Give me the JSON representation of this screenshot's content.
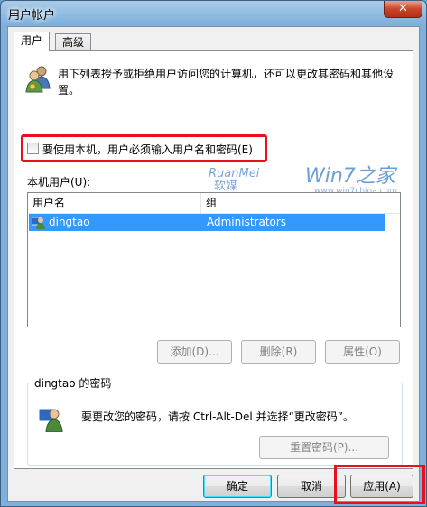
{
  "window": {
    "title": "用户帐户",
    "close_label": "✕"
  },
  "tabs": [
    {
      "label": "用户"
    },
    {
      "label": "高级"
    }
  ],
  "description": "用下列表授予或拒绝用户访问您的计算机，还可以更改其密码和其他设置。",
  "checkbox": {
    "label": "要使用本机，用户必须输入用户名和密码(E)",
    "checked": false
  },
  "watermark": {
    "ruanmei": "RuanMei",
    "ruanmei_cn": "软媒",
    "win7": "Win7之家",
    "win7_url": "www.win7china.com"
  },
  "users_section": {
    "label": "本机用户(U):"
  },
  "table": {
    "columns": [
      "用户名",
      "组"
    ],
    "rows": [
      {
        "name": "dingtao",
        "group": "Administrators",
        "selected": true
      }
    ]
  },
  "user_buttons": {
    "add": "添加(D)...",
    "remove": "删除(R)",
    "properties": "属性(O)"
  },
  "password_group": {
    "title": "dingtao 的密码",
    "text": "要更改您的密码，请按 Ctrl-Alt-Del 并选择“更改密码”。",
    "reset_button": "重置密码(P)..."
  },
  "dialog_buttons": {
    "ok": "确定",
    "cancel": "取消",
    "apply": "应用(A)"
  },
  "colors": {
    "highlight": "#3399ff",
    "annotation_red": "#e8101a"
  }
}
